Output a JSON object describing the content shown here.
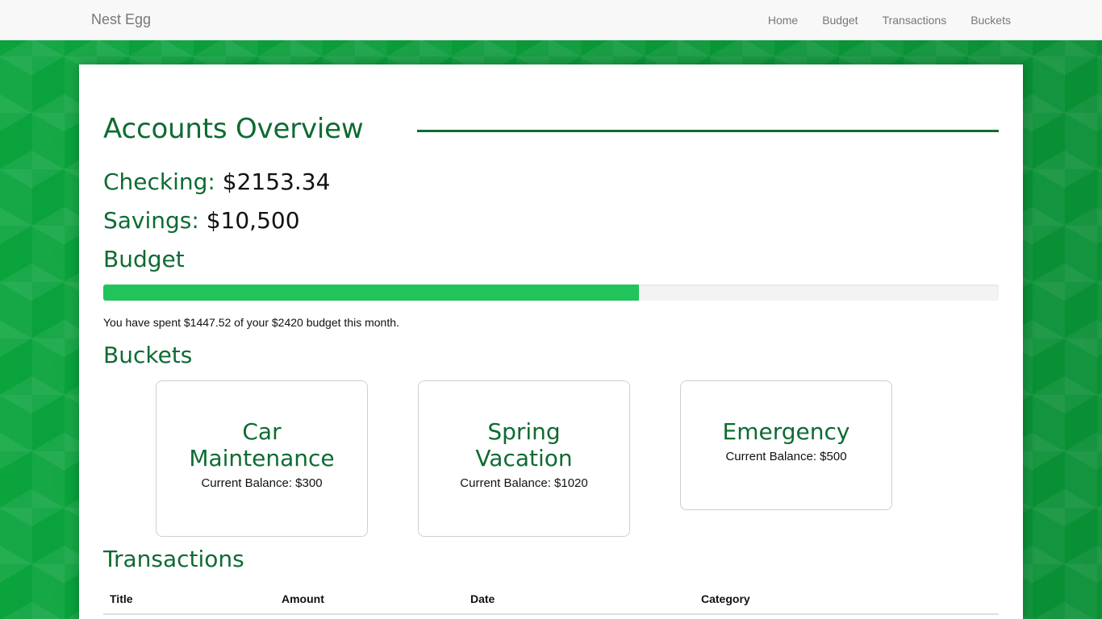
{
  "nav": {
    "brand": "Nest Egg",
    "links": [
      "Home",
      "Budget",
      "Transactions",
      "Buckets"
    ]
  },
  "overview": {
    "title": "Accounts Overview",
    "checking_label": "Checking:",
    "checking_value": "$2153.34",
    "savings_label": "Savings:",
    "savings_value": "$10,500"
  },
  "budget": {
    "title": "Budget",
    "progress_fraction": 0.598,
    "summary": "You have spent $1447.52 of your $2420 budget this month."
  },
  "buckets": {
    "title": "Buckets",
    "items": [
      {
        "name": "Car Maintenance",
        "balance": "Current Balance: $300"
      },
      {
        "name": "Spring Vacation",
        "balance": "Current Balance: $1020"
      },
      {
        "name": "Emergency",
        "balance": "Current Balance: $500"
      }
    ]
  },
  "transactions": {
    "title": "Transactions",
    "columns": [
      "Title",
      "Amount",
      "Date",
      "Category"
    ]
  },
  "colors": {
    "accent_green": "#0e6b32",
    "progress_green": "#22c35a",
    "background_green": "#0aa33c"
  }
}
